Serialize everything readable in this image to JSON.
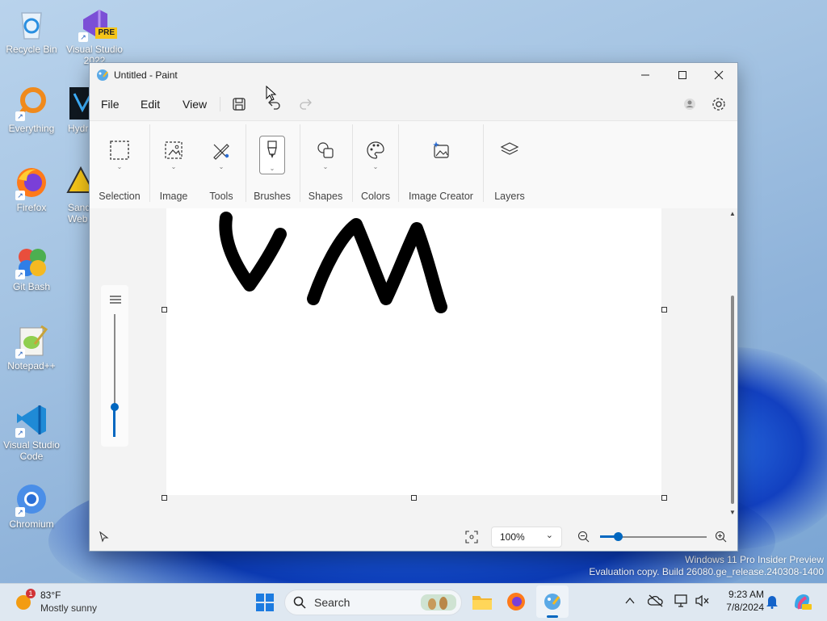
{
  "desktop": {
    "icons": [
      {
        "label": "Recycle Bin",
        "icon": "recycle-bin-icon"
      },
      {
        "label": "Visual Studio 2022",
        "badge": "PRE",
        "icon": "visual-studio-icon"
      },
      {
        "label": "Everything",
        "icon": "everything-search-icon"
      },
      {
        "label": "Hydr",
        "icon": "hydra-icon"
      },
      {
        "label": "Firefox",
        "icon": "firefox-icon"
      },
      {
        "label": "Sand Web",
        "icon": "sandbox-icon"
      },
      {
        "label": "Git Bash",
        "icon": "git-bash-icon"
      },
      {
        "label": "Notepad++",
        "icon": "notepad-plus-plus-icon"
      },
      {
        "label": "Visual Studio Code",
        "icon": "vscode-icon"
      },
      {
        "label": "Chromium",
        "icon": "chromium-icon"
      }
    ],
    "watermark": {
      "line1": "Windows 11 Pro Insider Preview",
      "line2": "Evaluation copy. Build 26080.ge_release.240308-1400"
    }
  },
  "paint": {
    "title": "Untitled - Paint",
    "menus": [
      "File",
      "Edit",
      "View"
    ],
    "ribbon": [
      "Selection",
      "Image",
      "Tools",
      "Brushes",
      "Shapes",
      "Colors",
      "Image Creator",
      "Layers"
    ],
    "active_tool": "Brushes",
    "zoom": "100%",
    "canvas_text_drawn": "VM"
  },
  "taskbar": {
    "weather": {
      "temp": "83°F",
      "condition": "Mostly sunny",
      "alert_count": "1"
    },
    "search_placeholder": "Search",
    "time": "9:23 AM",
    "date": "7/8/2024"
  },
  "colors": {
    "accent": "#0067c0",
    "stroke": "#000000"
  }
}
